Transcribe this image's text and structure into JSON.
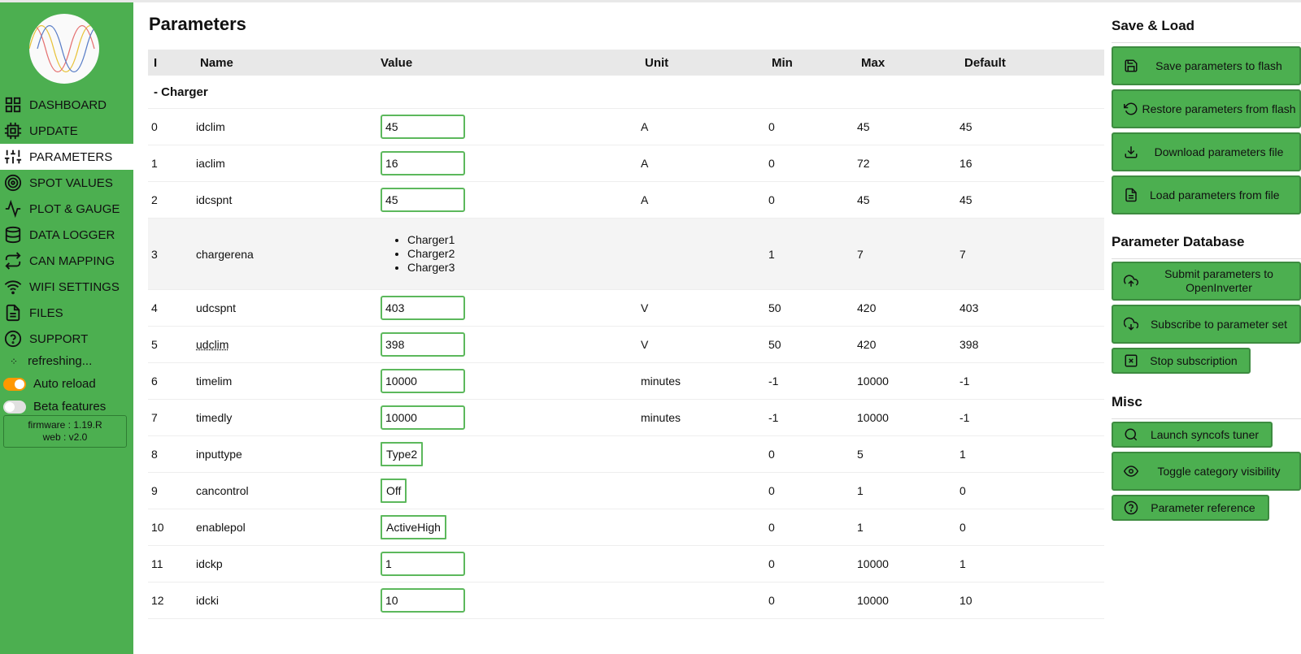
{
  "sidebar": {
    "nav": [
      {
        "label": "DASHBOARD",
        "icon": "dashboard-icon",
        "active": false
      },
      {
        "label": "UPDATE",
        "icon": "chip-icon",
        "active": false
      },
      {
        "label": "PARAMETERS",
        "icon": "sliders-icon",
        "active": true
      },
      {
        "label": "SPOT VALUES",
        "icon": "target-icon",
        "active": false
      },
      {
        "label": "PLOT & GAUGE",
        "icon": "activity-icon",
        "active": false
      },
      {
        "label": "DATA LOGGER",
        "icon": "database-icon",
        "active": false
      },
      {
        "label": "CAN MAPPING",
        "icon": "repeat-icon",
        "active": false
      },
      {
        "label": "WIFI SETTINGS",
        "icon": "wifi-icon",
        "active": false
      },
      {
        "label": "FILES",
        "icon": "file-icon",
        "active": false
      },
      {
        "label": "SUPPORT",
        "icon": "help-icon",
        "active": false
      }
    ],
    "refreshing_label": "refreshing...",
    "auto_reload_label": "Auto reload",
    "auto_reload_on": true,
    "beta_label": "Beta features",
    "beta_on": false,
    "firmware_label": "firmware : 1.19.R",
    "web_label": "web : v2.0"
  },
  "main": {
    "title": "Parameters",
    "columns": {
      "i": "I",
      "name": "Name",
      "value": "Value",
      "unit": "Unit",
      "min": "Min",
      "max": "Max",
      "default": "Default"
    },
    "category": "- Charger",
    "rows": [
      {
        "i": "0",
        "name": "idclim",
        "type": "input",
        "value": "45",
        "unit": "A",
        "min": "0",
        "max": "45",
        "default": "45"
      },
      {
        "i": "1",
        "name": "iaclim",
        "type": "input",
        "value": "16",
        "unit": "A",
        "min": "0",
        "max": "72",
        "default": "16"
      },
      {
        "i": "2",
        "name": "idcspnt",
        "type": "input",
        "value": "45",
        "unit": "A",
        "min": "0",
        "max": "45",
        "default": "45"
      },
      {
        "i": "3",
        "name": "chargerena",
        "type": "list",
        "items": [
          "Charger1",
          "Charger2",
          "Charger3"
        ],
        "unit": "",
        "min": "1",
        "max": "7",
        "default": "7"
      },
      {
        "i": "4",
        "name": "udcspnt",
        "type": "input",
        "value": "403",
        "unit": "V",
        "min": "50",
        "max": "420",
        "default": "403"
      },
      {
        "i": "5",
        "name": "udclim",
        "type": "input",
        "value": "398",
        "unit": "V",
        "min": "50",
        "max": "420",
        "default": "398"
      },
      {
        "i": "6",
        "name": "timelim",
        "type": "input",
        "value": "10000",
        "unit": "minutes",
        "min": "-1",
        "max": "10000",
        "default": "-1"
      },
      {
        "i": "7",
        "name": "timedly",
        "type": "input",
        "value": "10000",
        "unit": "minutes",
        "min": "-1",
        "max": "10000",
        "default": "-1"
      },
      {
        "i": "8",
        "name": "inputtype",
        "type": "select",
        "value": "Type2",
        "unit": "",
        "min": "0",
        "max": "5",
        "default": "1"
      },
      {
        "i": "9",
        "name": "cancontrol",
        "type": "select",
        "value": "Off",
        "unit": "",
        "min": "0",
        "max": "1",
        "default": "0"
      },
      {
        "i": "10",
        "name": "enablepol",
        "type": "select",
        "value": "ActiveHigh",
        "unit": "",
        "min": "0",
        "max": "1",
        "default": "0"
      },
      {
        "i": "11",
        "name": "idckp",
        "type": "input",
        "value": "1",
        "unit": "",
        "min": "0",
        "max": "10000",
        "default": "1"
      },
      {
        "i": "12",
        "name": "idcki",
        "type": "input",
        "value": "10",
        "unit": "",
        "min": "0",
        "max": "10000",
        "default": "10"
      }
    ]
  },
  "right": {
    "save_load_title": "Save & Load",
    "save_flash": "Save parameters to flash",
    "restore_flash": "Restore parameters from flash",
    "download_file": "Download parameters file",
    "load_file": "Load parameters from file",
    "database_title": "Parameter Database",
    "submit": "Submit parameters to OpenInverter",
    "subscribe": "Subscribe to parameter set",
    "stop_subscription": "Stop subscription",
    "misc_title": "Misc",
    "syncofs": "Launch syncofs tuner",
    "toggle_visibility": "Toggle category visibility",
    "reference": "Parameter reference"
  },
  "colors": {
    "accent": "#4caf50",
    "input_border": "#5cb85c",
    "toggle_on": "#ff9800"
  }
}
